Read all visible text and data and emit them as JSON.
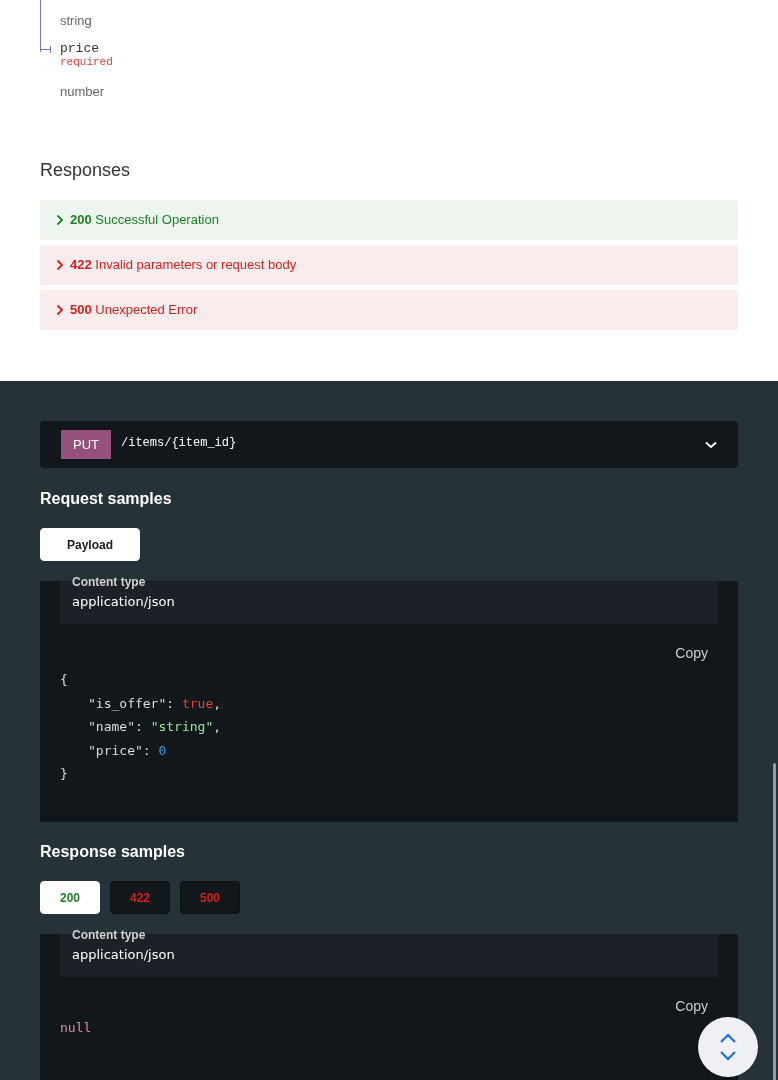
{
  "schema": {
    "fields": [
      {
        "type": "string"
      },
      {
        "name": "price",
        "required": "required",
        "type": "number"
      }
    ]
  },
  "responses": {
    "title": "Responses",
    "items": [
      {
        "code": "200",
        "description": "Successful Operation",
        "kind": "success",
        "expanded": false
      },
      {
        "code": "422",
        "description": "Invalid parameters or request body",
        "kind": "error",
        "expanded": false
      },
      {
        "code": "500",
        "description": "Unexpected Error",
        "kind": "error",
        "expanded": false
      }
    ]
  },
  "endpoint": {
    "method": "PUT",
    "path": "/items/{item_id}",
    "expanded": false
  },
  "request_samples": {
    "title": "Request samples",
    "tabs": [
      {
        "label": "Payload",
        "kind": "neutral",
        "selected": true
      }
    ],
    "content_type_label": "Content type",
    "content_type_value": "application/json",
    "copy_label": "Copy",
    "code": {
      "open": "{",
      "close": "}",
      "entries": [
        {
          "key": "\"is_offer\"",
          "colon": ":",
          "value": "true",
          "kind": "boolean",
          "comma": ","
        },
        {
          "key": "\"name\"",
          "colon": ":",
          "value": "\"string\"",
          "kind": "string",
          "comma": ","
        },
        {
          "key": "\"price\"",
          "colon": ":",
          "value": "0",
          "kind": "number"
        }
      ]
    }
  },
  "response_samples": {
    "title": "Response samples",
    "tabs": [
      {
        "label": "200",
        "kind": "success",
        "selected": true
      },
      {
        "label": "422",
        "kind": "error",
        "selected": false
      },
      {
        "label": "500",
        "kind": "error",
        "selected": false
      }
    ],
    "content_type_label": "Content type",
    "content_type_value": "application/json",
    "copy_label": "Copy",
    "code": {
      "value": "null",
      "kind": "null"
    }
  }
}
